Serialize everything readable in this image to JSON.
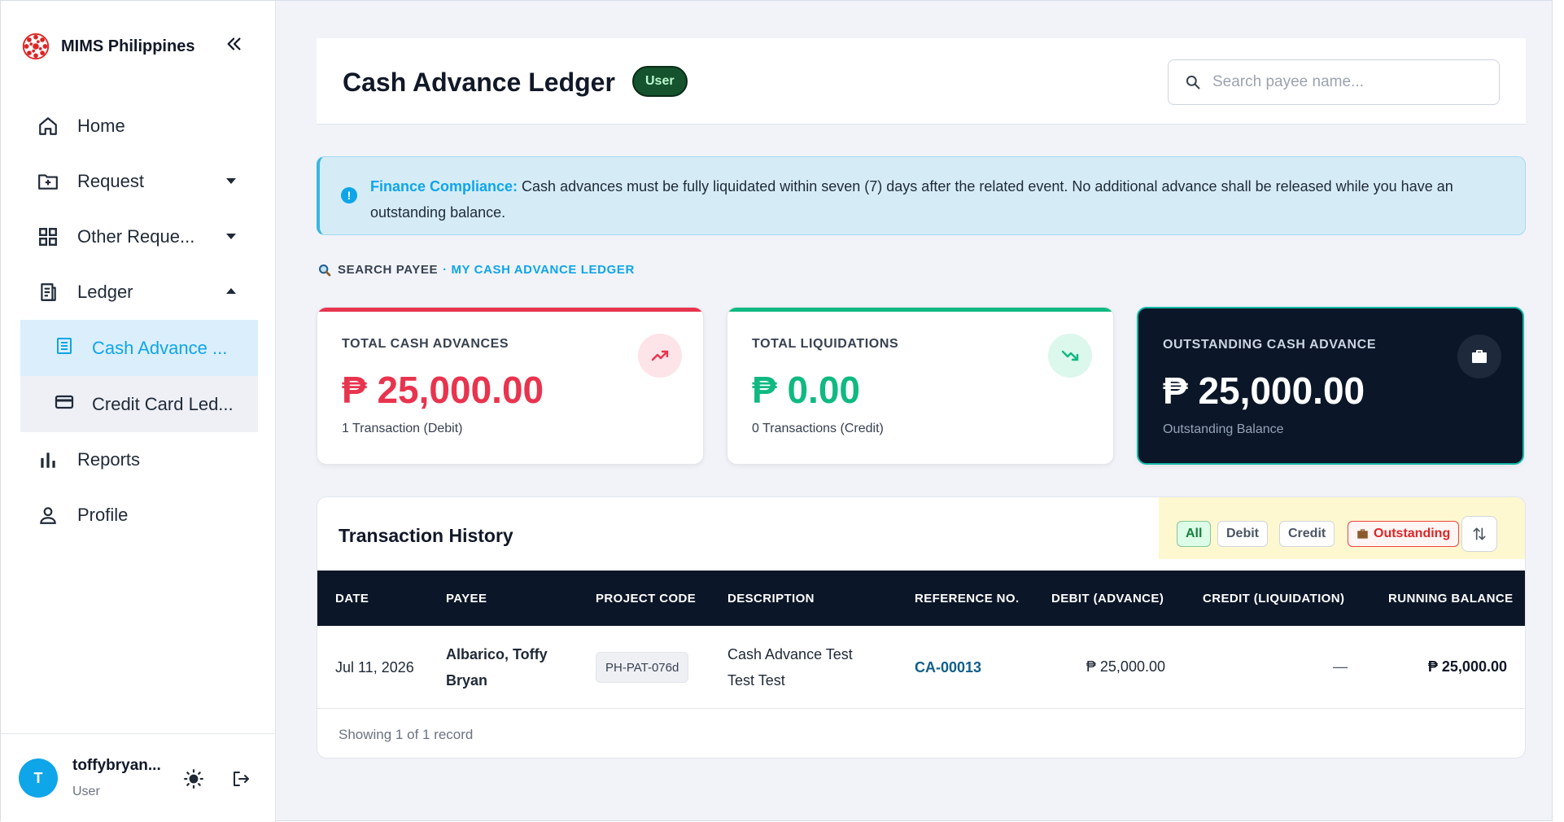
{
  "app": {
    "name": "MIMS Philippines"
  },
  "sidebar": {
    "items": [
      {
        "label": "Home",
        "icon": "home-icon"
      },
      {
        "label": "Request",
        "icon": "folder-plus-icon",
        "caret": "down"
      },
      {
        "label": "Other Reque...",
        "icon": "grid-icon",
        "caret": "down"
      },
      {
        "label": "Ledger",
        "icon": "ledger-icon",
        "caret": "up"
      },
      {
        "label": "Reports",
        "icon": "bar-chart-icon"
      },
      {
        "label": "Profile",
        "icon": "person-icon"
      }
    ],
    "sub_items": [
      {
        "label": "Cash Advance ...",
        "icon": "document-icon",
        "active": true
      },
      {
        "label": "Credit Card Led...",
        "icon": "credit-card-icon"
      }
    ]
  },
  "user": {
    "initial": "T",
    "name": "toffybryan...",
    "role": "User"
  },
  "header": {
    "title": "Cash Advance Ledger",
    "badge": "User",
    "search_placeholder": "Search payee name..."
  },
  "alert": {
    "label": "Finance Compliance:",
    "text": " Cash advances must be fully liquidated within seven (7) days after the related event. No additional advance shall be released while you have an outstanding balance."
  },
  "section": {
    "label_a": "SEARCH PAYEE",
    "label_b": "· MY CASH ADVANCE LEDGER"
  },
  "cards": [
    {
      "title": "TOTAL CASH ADVANCES",
      "amount": "₱ 25,000.00",
      "sub": "1 Transaction (Debit)",
      "color": "#e8344e"
    },
    {
      "title": "TOTAL LIQUIDATIONS",
      "amount": "₱ 0.00",
      "sub": "0 Transactions (Credit)",
      "color": "#10b981"
    },
    {
      "title": "OUTSTANDING CASH ADVANCE",
      "amount": "₱ 25,000.00",
      "sub": "Outstanding Balance",
      "color": "#ffffff"
    }
  ],
  "transactions": {
    "title": "Transaction History",
    "filters": [
      "All",
      "Debit",
      "Credit",
      "Outstanding"
    ],
    "columns": [
      "DATE",
      "PAYEE",
      "PROJECT CODE",
      "DESCRIPTION",
      "REFERENCE NO.",
      "DEBIT (ADVANCE)",
      "CREDIT (LIQUIDATION)",
      "RUNNING BALANCE"
    ],
    "rows": [
      {
        "date": "Jul 11, 2026",
        "payee_line1": "Albarico, Toffy",
        "payee_line2": "Bryan",
        "project_code": "PH-PAT-076d",
        "desc_line1": "Cash Advance Test",
        "desc_line2": "Test Test",
        "reference": "CA-00013",
        "debit": "₱ 25,000.00",
        "credit": "—",
        "balance": "₱ 25,000.00"
      }
    ],
    "footer": "Showing 1 of 1 record"
  }
}
